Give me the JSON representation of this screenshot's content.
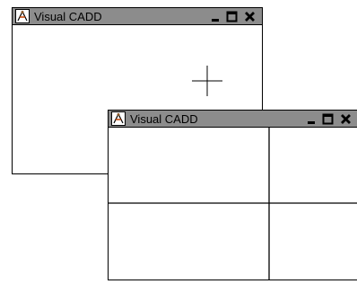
{
  "windows": [
    {
      "title": "Visual CADD"
    },
    {
      "title": "Visual CADD"
    }
  ],
  "icons": {
    "app": "visual-cadd-app-icon",
    "minimize": "minimize-icon",
    "maximize": "maximize-icon",
    "close": "close-icon"
  }
}
